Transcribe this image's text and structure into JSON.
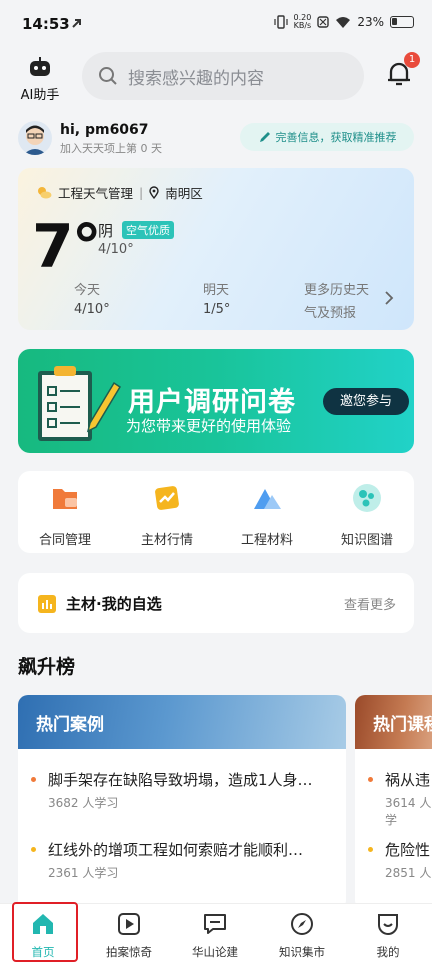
{
  "status": {
    "time": "14:53",
    "speed_value": "0.20",
    "speed_unit": "KB/s",
    "battery": "23%"
  },
  "header": {
    "ai_label": "AI助手",
    "search_placeholder": "搜索感兴趣的内容",
    "notification_count": "1"
  },
  "user": {
    "greeting": "hi, pm6067",
    "subtitle": "加入天天项上第 0 天",
    "complete_btn": "完善信息，获取精准推荐"
  },
  "weather": {
    "manage": "工程天气管理",
    "location": "南明区",
    "temp": "7°",
    "condition": "阴",
    "air_quality": "空气优质",
    "range": "4/10°",
    "today_label": "今天",
    "today_value": "4/10°",
    "tomorrow_label": "明天",
    "tomorrow_value": "1/5°",
    "more_line1": "更多历史天",
    "more_line2": "气及预报"
  },
  "banner": {
    "title": "用户调研问卷",
    "subtitle": "为您带来更好的使用体验",
    "button": "邀您参与"
  },
  "quick": [
    {
      "label": "合同管理",
      "icon": "contract-icon",
      "color": "#f07a3a"
    },
    {
      "label": "主材行情",
      "icon": "trend-icon",
      "color": "#f5b51e"
    },
    {
      "label": "工程材料",
      "icon": "materials-icon",
      "color": "#4f9df0"
    },
    {
      "label": "知识图谱",
      "icon": "knowledge-graph-icon",
      "color": "#2cc3b8"
    }
  ],
  "favorites": {
    "title": "主材·我的自选",
    "more": "查看更多"
  },
  "section_title": "飙升榜",
  "ranking": [
    {
      "title": "热门案例",
      "items": [
        {
          "text": "脚手架存在缺陷导致坍塌，造成1人身…",
          "meta": "3682 人学习"
        },
        {
          "text": "红线外的增项工程如何索赔才能顺利…",
          "meta": "2361 人学习"
        }
      ]
    },
    {
      "title": "热门课程",
      "items": [
        {
          "text": "祸从违",
          "meta": "3614 人学"
        },
        {
          "text": "危险性",
          "meta": "2851 人"
        }
      ]
    }
  ],
  "nav": [
    {
      "label": "首页",
      "icon": "home-icon"
    },
    {
      "label": "拍案惊奇",
      "icon": "play-icon"
    },
    {
      "label": "华山论建",
      "icon": "chat-icon"
    },
    {
      "label": "知识集市",
      "icon": "compass-icon"
    },
    {
      "label": "我的",
      "icon": "profile-icon"
    }
  ],
  "colors": {
    "accent": "#2cc3b8",
    "active_nav": "#22b7b0",
    "highlight_border": "#e01f26"
  }
}
